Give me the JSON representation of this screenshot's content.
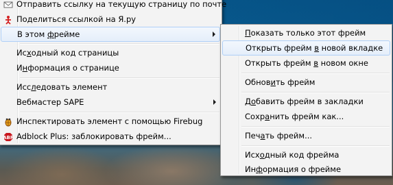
{
  "main_menu": {
    "items": [
      {
        "pre": "Отправить ссылку на текущую страницу по почте",
        "key": "",
        "post": ""
      },
      {
        "pre": "Поделиться ссылкой на Я.ру",
        "key": "",
        "post": ""
      },
      {
        "pre": "В этом ",
        "key": "ф",
        "post": "рейме"
      },
      {
        "pre": "Ис",
        "key": "х",
        "post": "одный код страницы"
      },
      {
        "pre": "И",
        "key": "н",
        "post": "формация о странице"
      },
      {
        "pre": "Исс",
        "key": "л",
        "post": "едовать элемент"
      },
      {
        "pre": "Вебмастер SAPE",
        "key": "",
        "post": ""
      },
      {
        "pre": "Инспектировать элемент с помощью Firebug",
        "key": "",
        "post": ""
      },
      {
        "pre": "Adblock Plus: заблокировать фрейм...",
        "key": "",
        "post": ""
      }
    ]
  },
  "sub_menu": {
    "items": [
      {
        "pre": "",
        "key": "П",
        "post": "оказать только этот фрейм"
      },
      {
        "pre": "Открыть фрейм ",
        "key": "в",
        "post": " новой вкладке"
      },
      {
        "pre": "Открыть фрейм ",
        "key": "в",
        "post": " новом окне"
      },
      {
        "pre": "Обнов",
        "key": "и",
        "post": "ть фрейм"
      },
      {
        "pre": "Д",
        "key": "о",
        "post": "бавить фрейм в закладки"
      },
      {
        "pre": "Сохр",
        "key": "а",
        "post": "нить фрейм как..."
      },
      {
        "pre": "Печ",
        "key": "а",
        "post": "ть фрейм..."
      },
      {
        "pre": "Исх",
        "key": "о",
        "post": "дный код фрейма"
      },
      {
        "pre": "Ин",
        "key": "ф",
        "post": "ормация о фрейме"
      }
    ]
  },
  "icons": {
    "mail": "mail-icon",
    "share": "share-icon",
    "firebug": "firebug-icon",
    "adblock": "adblock-icon"
  },
  "colors": {
    "menu_bg": "#f3f3f3",
    "hover_border": "#aecff7",
    "hover_bg": "#e5eefa"
  }
}
